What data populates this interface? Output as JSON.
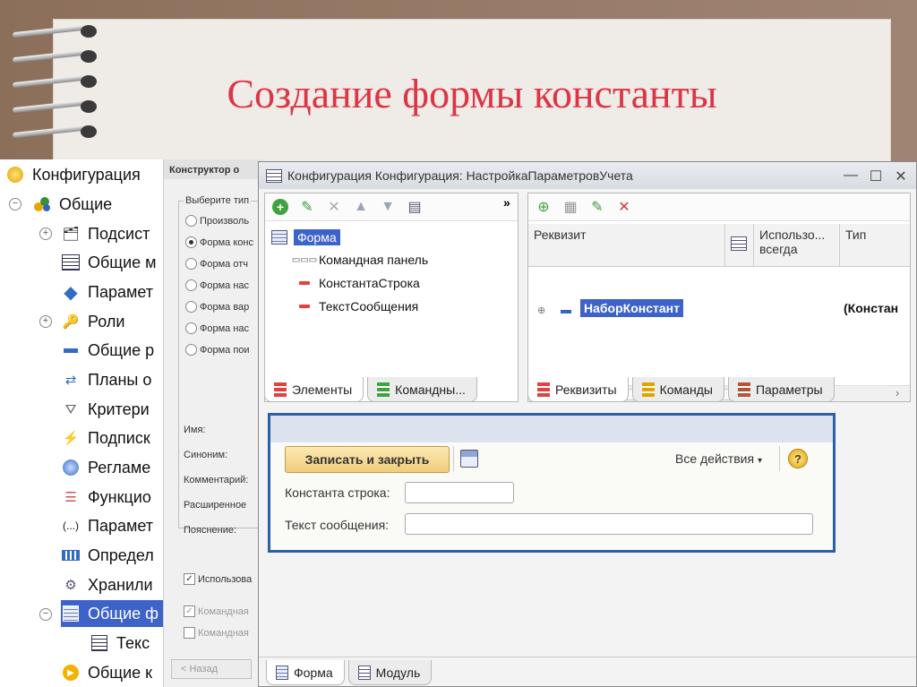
{
  "slide": {
    "title": "Создание формы константы"
  },
  "tree": {
    "items": [
      {
        "label": "Конфигурация",
        "icon": "yellow-circle-icon"
      },
      {
        "label": "Общие",
        "icon": "shapes-icon"
      },
      {
        "label": "Подсист",
        "icon": "subsystems-icon"
      },
      {
        "label": "Общие м",
        "icon": "module-icon"
      },
      {
        "label": "Парамет",
        "icon": "diamond-icon"
      },
      {
        "label": "Роли",
        "icon": "key-icon"
      },
      {
        "label": "Общие р",
        "icon": "attribute-icon"
      },
      {
        "label": "Планы о",
        "icon": "exchange-plans-icon"
      },
      {
        "label": "Критери",
        "icon": "filter-icon"
      },
      {
        "label": "Подписк",
        "icon": "lightning-icon"
      },
      {
        "label": "Регламе",
        "icon": "clock-icon"
      },
      {
        "label": "Функцио",
        "icon": "list-icon"
      },
      {
        "label": "Парамет",
        "icon": "parentheses-icon"
      },
      {
        "label": "Определ",
        "icon": "definitions-icon"
      },
      {
        "label": "Хранили",
        "icon": "storage-icon"
      },
      {
        "label": "Общие ф",
        "icon": "form-icon"
      },
      {
        "label": "Текс",
        "icon": "form-icon"
      },
      {
        "label": "Общие к",
        "icon": "play-icon"
      }
    ]
  },
  "constructor": {
    "title": "Конструктор о",
    "group_label": "Выберите тип",
    "radios": [
      "Произволь",
      "Форма конс",
      "Форма отч",
      "Форма нас",
      "Форма вар",
      "Форма нас",
      "Форма пои"
    ],
    "fields": [
      "Имя:",
      "Синоним:",
      "Комментарий:",
      "Расширенное",
      "Пояснение:"
    ],
    "checks": [
      "Использова",
      "Командная",
      "Командная"
    ],
    "back_label": "< Назад"
  },
  "window": {
    "title": "Конфигурация Конфигурация: НастройкаПараметровУчета",
    "elements": {
      "nodes": [
        "Форма",
        "Командная панель",
        "КонстантаСтрока",
        "ТекстСообщения"
      ],
      "more_label": "»"
    },
    "requisites": {
      "columns": [
        "Реквизит",
        "Использо... всегда",
        "Тип"
      ],
      "row_name": "НаборКонстант",
      "row_type": "(Констан"
    },
    "left_tabs": [
      "Элементы",
      "Командны..."
    ],
    "right_tabs": [
      "Реквизиты",
      "Команды",
      "Параметры"
    ],
    "bottom_tabs": [
      "Форма",
      "Модуль"
    ]
  },
  "preview": {
    "save_close_label": "Записать и закрыть",
    "all_actions_label": "Все действия",
    "help_label": "?",
    "field1_label": "Константа строка:",
    "field2_label": "Текст сообщения:",
    "field1_value": "",
    "field2_value": ""
  }
}
